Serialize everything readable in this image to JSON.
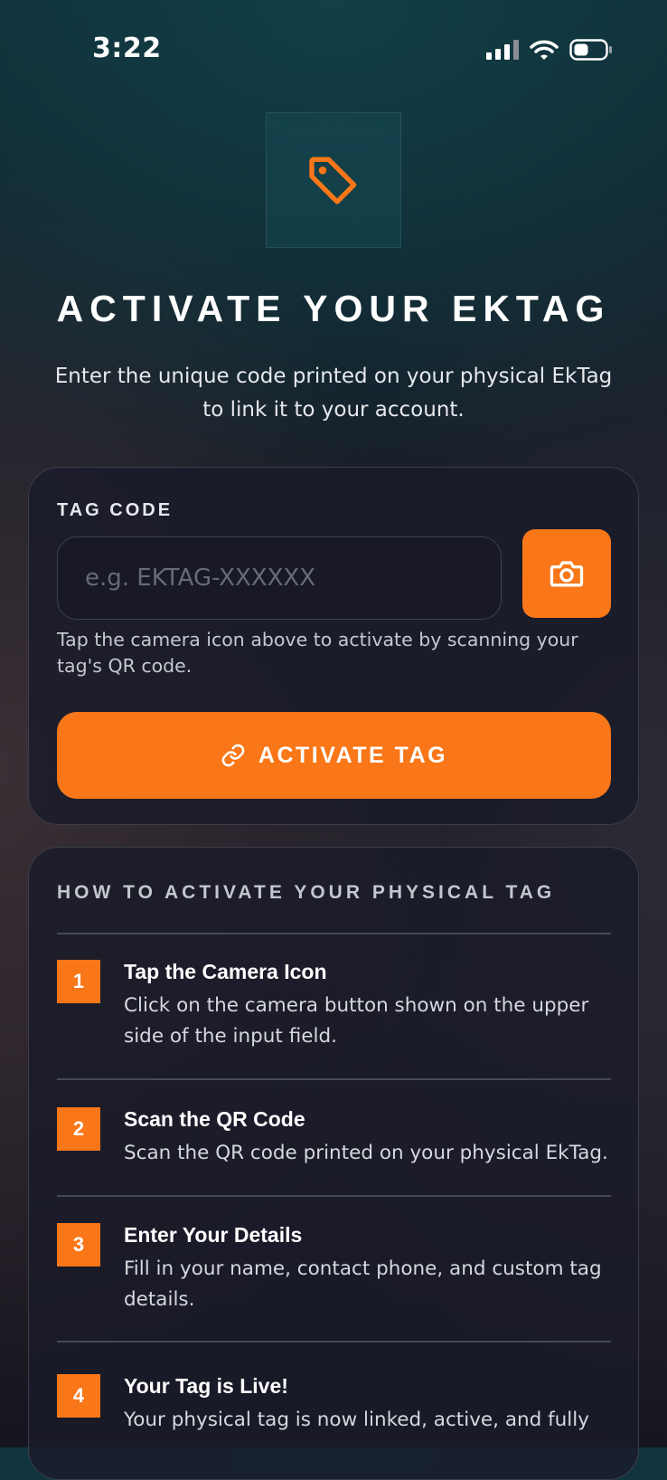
{
  "status_bar": {
    "time": "3:22"
  },
  "header": {
    "title": "ACTIVATE YOUR EKTAG",
    "subtitle": "Enter the unique code printed on your physical EkTag to link it to your account."
  },
  "form": {
    "label": "TAG CODE",
    "placeholder": "e.g. EKTAG-XXXXXX",
    "value": "",
    "helper": "Tap the camera icon above to activate by scanning your tag's QR code.",
    "button_label": "ACTIVATE TAG"
  },
  "instructions": {
    "title": "HOW TO ACTIVATE YOUR PHYSICAL TAG",
    "steps": [
      {
        "number": "1",
        "title": "Tap the Camera Icon",
        "description": "Click on the camera button shown on the upper side of the input field."
      },
      {
        "number": "2",
        "title": "Scan the QR Code",
        "description": "Scan the QR code printed on your physical EkTag."
      },
      {
        "number": "3",
        "title": "Enter Your Details",
        "description": "Fill in your name, contact phone, and custom tag details."
      },
      {
        "number": "4",
        "title": "Your Tag is Live!",
        "description": "Your physical tag is now linked, active, and fully"
      }
    ]
  },
  "colors": {
    "accent": "#f97718",
    "logo_box": "#164852",
    "card": "#1a1b2a"
  },
  "icons": {
    "logo": "tag-icon",
    "scan": "camera-icon",
    "activate": "link-icon"
  }
}
